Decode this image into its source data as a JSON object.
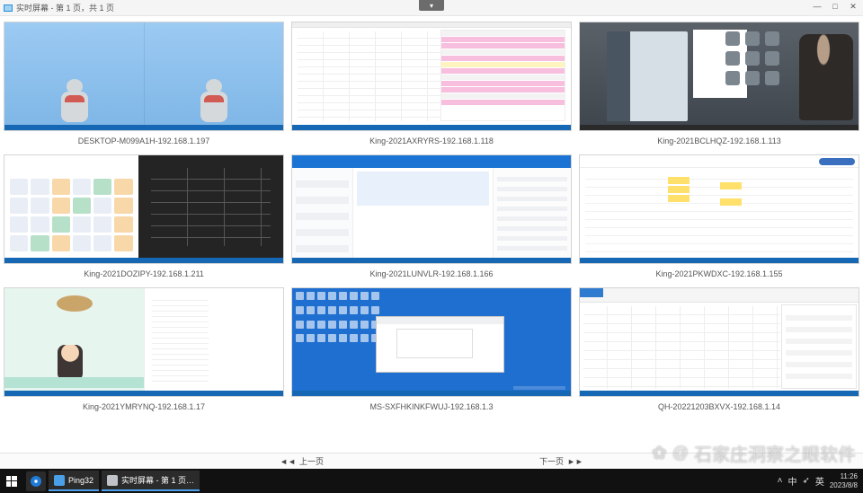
{
  "window": {
    "title": "实时屏幕 - 第 1 页，共 1 页",
    "min": "—",
    "max": "□",
    "close": "✕",
    "chev": "▾"
  },
  "thumbs": [
    {
      "caption": "DESKTOP-M099A1H-192.168.1.197"
    },
    {
      "caption": "King-2021AXRYRS-192.168.1.118"
    },
    {
      "caption": "King-2021BCLHQZ-192.168.1.113"
    },
    {
      "caption": "King-2021DOZIPY-192.168.1.211"
    },
    {
      "caption": "King-2021LUNVLR-192.168.1.166"
    },
    {
      "caption": "King-2021PKWDXC-192.168.1.155"
    },
    {
      "caption": "King-2021YMRYNQ-192.168.1.17"
    },
    {
      "caption": "MS-SXFHKINKFWUJ-192.168.1.3"
    },
    {
      "caption": "QH-20221203BXVX-192.168.1.14"
    }
  ],
  "pager": {
    "prev": "上一页",
    "next": "下一页",
    "larr": "◄◄",
    "rarr": "►►"
  },
  "taskbar": {
    "app1": "Ping32",
    "app2": "实时屏幕 - 第 1 页…",
    "tray": {
      "up": "˄",
      "ime1": "中",
      "ime2": "➶",
      "ime3": "英",
      "time": "11:26",
      "date": "2023/8/8"
    }
  },
  "watermark": {
    "paw": "✿",
    "at": "@",
    "text": "石家庄洞察之眼软件"
  }
}
